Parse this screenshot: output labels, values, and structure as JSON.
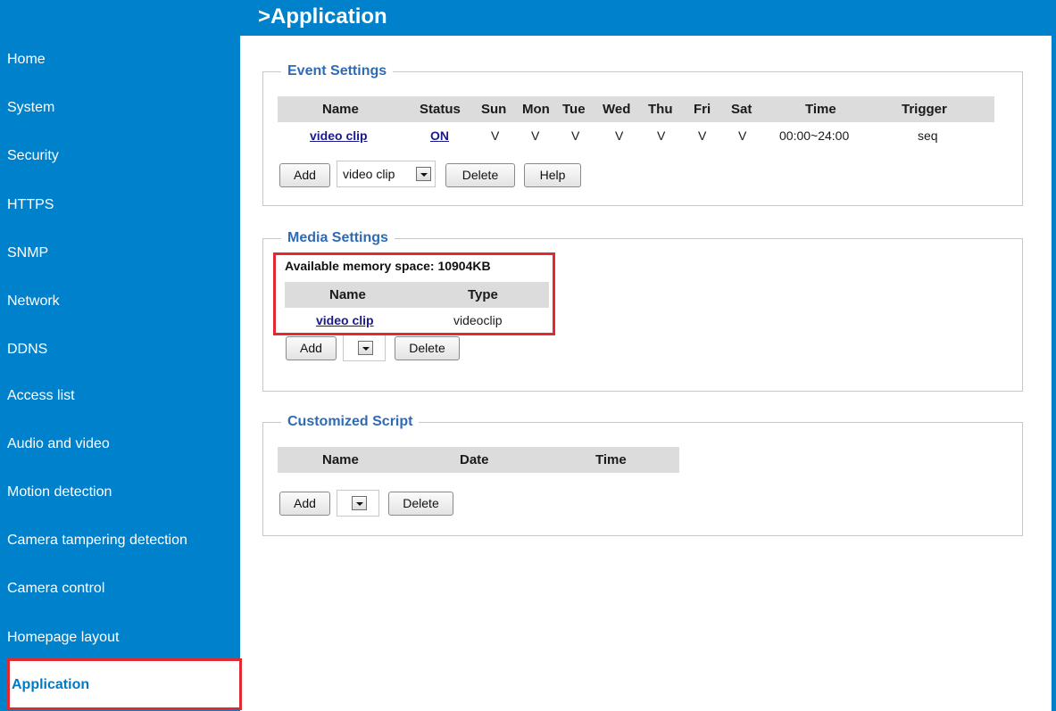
{
  "header": {
    "title": ">Application"
  },
  "sidebar": {
    "items": [
      {
        "label": "Home"
      },
      {
        "label": "System"
      },
      {
        "label": "Security"
      },
      {
        "label": "HTTPS"
      },
      {
        "label": "SNMP"
      },
      {
        "label": "Network"
      },
      {
        "label": "DDNS"
      },
      {
        "label": "Access list"
      },
      {
        "label": "Audio and video"
      },
      {
        "label": "Motion detection"
      },
      {
        "label": "Camera tampering detection"
      },
      {
        "label": "Camera control"
      },
      {
        "label": "Homepage layout"
      },
      {
        "label": "Application"
      }
    ],
    "active": "Application"
  },
  "event_settings": {
    "legend": "Event Settings",
    "columns": [
      "Name",
      "Status",
      "Sun",
      "Mon",
      "Tue",
      "Wed",
      "Thu",
      "Fri",
      "Sat",
      "Time",
      "Trigger"
    ],
    "row": {
      "name": "video clip",
      "status": "ON",
      "sun": "V",
      "mon": "V",
      "tue": "V",
      "wed": "V",
      "thu": "V",
      "fri": "V",
      "sat": "V",
      "time": "00:00~24:00",
      "trigger": "seq"
    },
    "add_label": "Add",
    "select_value": "video clip",
    "delete_label": "Delete",
    "help_label": "Help"
  },
  "media_settings": {
    "legend": "Media Settings",
    "memory_label": "Available memory space: 10904KB",
    "columns": [
      "Name",
      "Type"
    ],
    "row": {
      "name": "video clip",
      "type": "videoclip"
    },
    "add_label": "Add",
    "delete_label": "Delete"
  },
  "customized_script": {
    "legend": "Customized Script",
    "columns": [
      "Name",
      "Date",
      "Time"
    ],
    "add_label": "Add",
    "delete_label": "Delete"
  },
  "colors": {
    "brand_blue": "#0081cc",
    "highlight_red": "#e02a2f",
    "legend_blue": "#2f6ab4"
  }
}
